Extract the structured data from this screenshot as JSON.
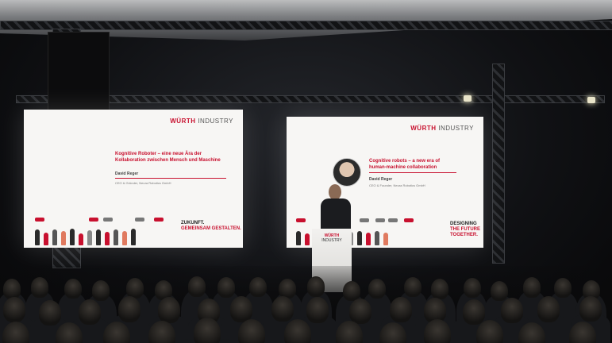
{
  "left_slide": {
    "brand_red": "WÜRTH",
    "brand_gray": "INDUSTRY",
    "title": "Kognitive Roboter – eine neue Ära der Kollaboration zwischen Mensch und Maschine",
    "name": "David Reger",
    "role": "CEO & Gründer, Neura Robotics GmbH",
    "slogan_line1": "ZUKUNFT.",
    "slogan_line2": "GEMEINSAM GESTALTEN."
  },
  "right_slide": {
    "brand_red": "WÜRTH",
    "brand_gray": "INDUSTRY",
    "title": "Cognitive robots – a new era of human-machine collaboration",
    "name": "David Reger",
    "role": "CEO & Founder, Neura Robotics GmbH",
    "slogan_line1": "DESIGNING",
    "slogan_line2": "THE FUTURE",
    "slogan_line3": "TOGETHER."
  },
  "lectern": {
    "brand_red": "WÜRTH",
    "brand_gray": "INDUSTRY"
  },
  "colors": {
    "brand_red": "#c8102e"
  }
}
